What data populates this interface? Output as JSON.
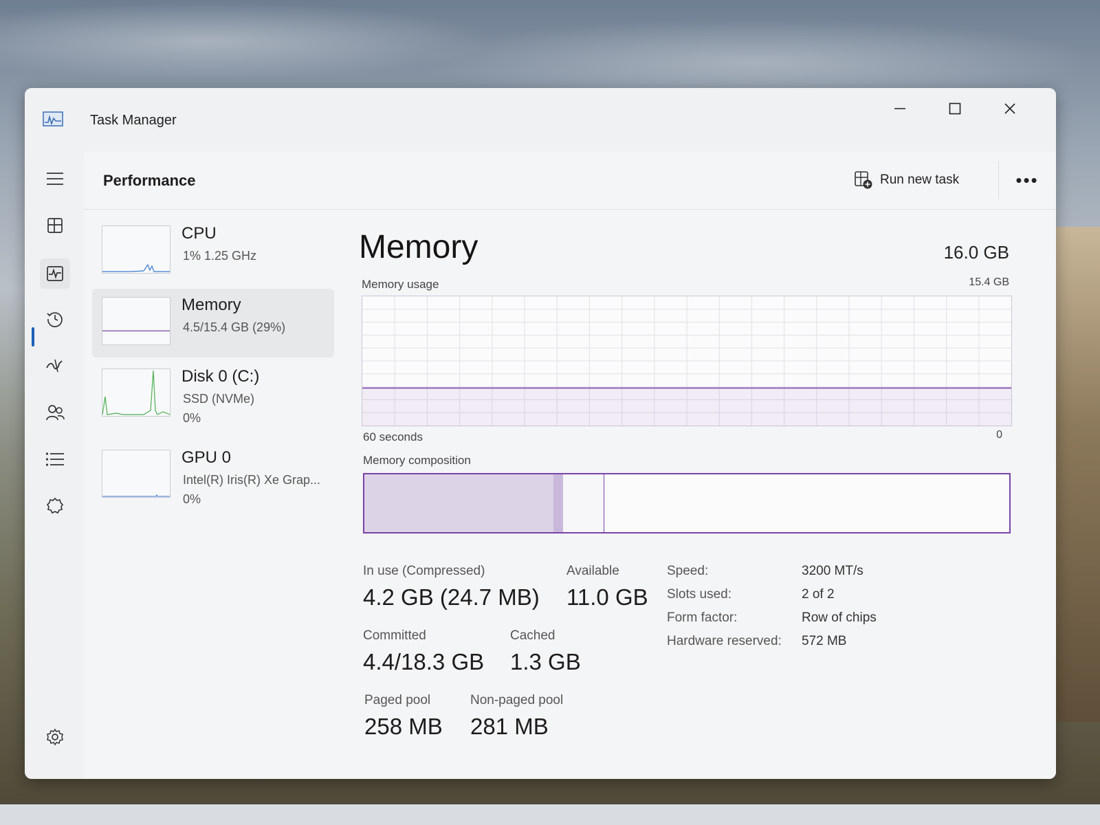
{
  "window": {
    "title": "Task Manager"
  },
  "nav": {
    "items": [
      {
        "icon": "hamburger-menu-icon"
      },
      {
        "icon": "processes-icon"
      },
      {
        "icon": "performance-icon",
        "active": true
      },
      {
        "icon": "app-history-icon"
      },
      {
        "icon": "startup-apps-icon"
      },
      {
        "icon": "users-icon"
      },
      {
        "icon": "details-icon"
      },
      {
        "icon": "services-icon"
      },
      {
        "icon": "settings-icon"
      }
    ]
  },
  "header": {
    "title": "Performance",
    "run_new_task": "Run new task",
    "more": "•••"
  },
  "resources": [
    {
      "name": "CPU",
      "sub": "1%  1.25 GHz",
      "sub2": ""
    },
    {
      "name": "Memory",
      "sub": "4.5/15.4 GB (29%)",
      "sub2": "",
      "selected": true
    },
    {
      "name": "Disk 0 (C:)",
      "sub": "SSD (NVMe)",
      "sub2": "0%"
    },
    {
      "name": "GPU 0",
      "sub": "Intel(R) Iris(R) Xe Grap...",
      "sub2": "0%"
    }
  ],
  "memory": {
    "title": "Memory",
    "total": "16.0 GB",
    "usage_label": "Memory usage",
    "usage_max": "15.4 GB",
    "axis_left": "60 seconds",
    "axis_right": "0",
    "composition_label": "Memory composition",
    "usage_fraction": 0.29,
    "composition": {
      "in_use_fraction": 0.293,
      "modified_fraction": 0.015,
      "standby_fraction": 0.063
    },
    "stats": {
      "in_use_label": "In use (Compressed)",
      "in_use_value": "4.2 GB (24.7 MB)",
      "available_label": "Available",
      "available_value": "11.0 GB",
      "committed_label": "Committed",
      "committed_value": "4.4/18.3 GB",
      "cached_label": "Cached",
      "cached_value": "1.3 GB",
      "paged_pool_label": "Paged pool",
      "paged_pool_value": "258 MB",
      "nonpaged_pool_label": "Non-paged pool",
      "nonpaged_pool_value": "281 MB"
    },
    "properties": [
      {
        "key": "Speed:",
        "value": "3200 MT/s"
      },
      {
        "key": "Slots used:",
        "value": "2 of 2"
      },
      {
        "key": "Form factor:",
        "value": "Row of chips"
      },
      {
        "key": "Hardware reserved:",
        "value": "572 MB"
      }
    ]
  },
  "colors": {
    "accent": "#7a43a8",
    "nav_indicator": "#1f5fb8",
    "disk_graph": "#4caf50"
  }
}
